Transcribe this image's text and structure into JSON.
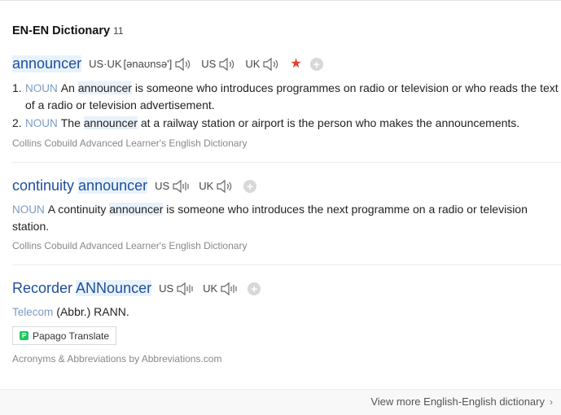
{
  "section": {
    "title": "EN-EN Dictionary",
    "count": "11"
  },
  "entries": [
    {
      "headword_plain": "",
      "headword_hl": "announcer",
      "pron_us_uk_label": "US·UK",
      "ipa": "[ənaʊnsə']",
      "us_label": "US",
      "uk_label": "UK",
      "defs": [
        {
          "num": "1.",
          "pos": "NOUN",
          "pre": "An ",
          "hl": "announcer",
          "post": " is someone who introduces programmes on radio or television or who reads the text of a radio or television advertisement."
        },
        {
          "num": "2.",
          "pos": "NOUN",
          "pre": "The ",
          "hl": "announcer",
          "post": " at a railway station or airport is the person who makes the announcements."
        }
      ],
      "source": "Collins Cobuild Advanced Learner's English Dictionary"
    },
    {
      "headword_plain": "continuity ",
      "headword_hl": "announcer",
      "us_label": "US",
      "uk_label": "UK",
      "def": {
        "pos": "NOUN",
        "pre": "A continuity ",
        "hl": "announcer",
        "post": " is someone who introduces the next programme on a radio or television station."
      },
      "source": "Collins Cobuild Advanced Learner's English Dictionary"
    },
    {
      "headword_part1": "Recorder",
      "headword_part2": "ANNouncer",
      "us_label": "US",
      "uk_label": "UK",
      "def": {
        "pos": "Telecom",
        "text": "(Abbr.) RANN."
      },
      "translate_button": "Papago Translate",
      "source": "Acronyms & Abbreviations by Abbreviations.com"
    }
  ],
  "footer": {
    "more": "View more English-English dictionary"
  },
  "icons": {
    "speaker": "speaker-icon",
    "bars": "speaker-bars-icon",
    "star": "star-icon",
    "plus": "add-icon",
    "chevron": "chevron-right-icon"
  },
  "colors": {
    "headword": "#1e4e9c",
    "highlight": "#e8f2fb",
    "pos": "#7b9bc4",
    "star": "#e24030"
  }
}
